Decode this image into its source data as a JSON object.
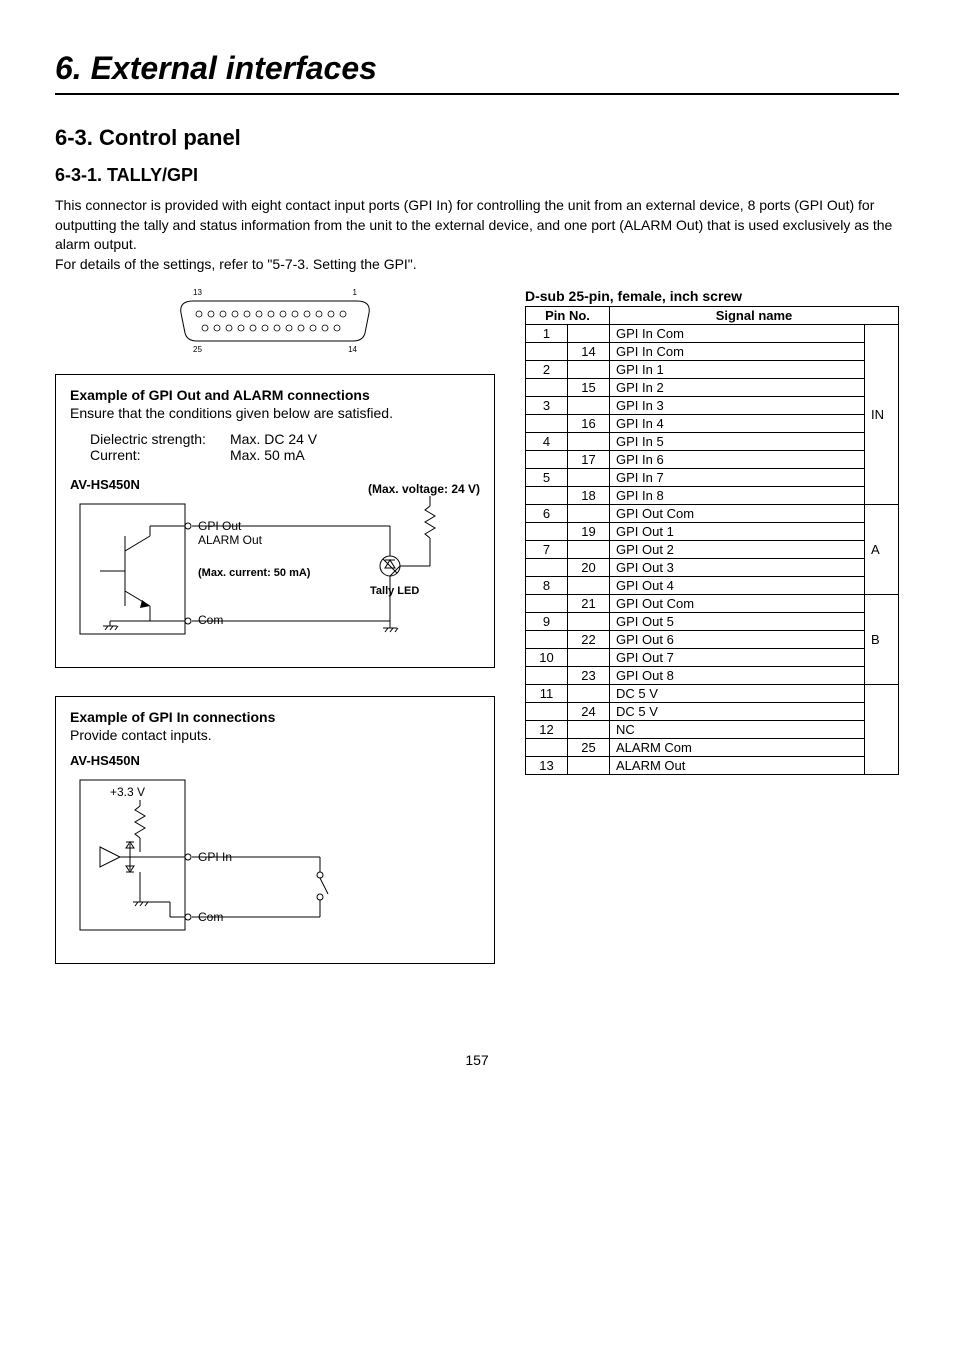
{
  "chapter": "6. External interfaces",
  "section": "6-3. Control panel",
  "subsection": "6-3-1. TALLY/GPI",
  "intro": "This connector is provided with eight contact input ports (GPI In) for controlling the unit from an external device, 8 ports (GPI Out) for outputting the tally and status information from the unit to the external device, and one port (ALARM Out) that is used exclusively as the alarm output.",
  "intro2": "For details of the settings, refer to \"5-7-3. Setting the GPI\".",
  "page_number": "157",
  "connector": {
    "top_left": "13",
    "top_right": "1",
    "bottom_left": "25",
    "bottom_right": "14"
  },
  "box1": {
    "title": "Example of GPI Out and ALARM connections",
    "sub": "Ensure that the conditions given below are satisfied.",
    "spec1_k": "Dielectric strength:",
    "spec1_v": "Max. DC 24 V",
    "spec2_k": "Current:",
    "spec2_v": "Max. 50 mA",
    "device": "AV-HS450N",
    "max_voltage": "(Max. voltage: 24 V)",
    "gpi_out": "GPI Out",
    "alarm_out": "ALARM Out",
    "max_current": "(Max. current: 50 mA)",
    "tally_led": "Tally LED",
    "com": "Com"
  },
  "box2": {
    "title": "Example of GPI In connections",
    "sub": "Provide contact inputs.",
    "device": "AV-HS450N",
    "v33": "+3.3 V",
    "gpi_in": "GPI In",
    "com": "Com"
  },
  "table": {
    "caption": "D-sub 25-pin, female, inch screw",
    "head_pin": "Pin No.",
    "head_sig": "Signal name",
    "rows": [
      {
        "a": "1",
        "b": "",
        "sig": "GPI In Com",
        "grp": "IN",
        "gstart": true,
        "gspan": 10
      },
      {
        "a": "",
        "b": "14",
        "sig": "GPI In Com"
      },
      {
        "a": "2",
        "b": "",
        "sig": "GPI In 1"
      },
      {
        "a": "",
        "b": "15",
        "sig": "GPI In 2"
      },
      {
        "a": "3",
        "b": "",
        "sig": "GPI In 3"
      },
      {
        "a": "",
        "b": "16",
        "sig": "GPI In 4"
      },
      {
        "a": "4",
        "b": "",
        "sig": "GPI In 5"
      },
      {
        "a": "",
        "b": "17",
        "sig": "GPI In 6"
      },
      {
        "a": "5",
        "b": "",
        "sig": "GPI In 7"
      },
      {
        "a": "",
        "b": "18",
        "sig": "GPI In 8"
      },
      {
        "a": "6",
        "b": "",
        "sig": "GPI Out Com",
        "grp": "A",
        "gstart": true,
        "gspan": 5
      },
      {
        "a": "",
        "b": "19",
        "sig": "GPI Out 1"
      },
      {
        "a": "7",
        "b": "",
        "sig": "GPI Out 2"
      },
      {
        "a": "",
        "b": "20",
        "sig": "GPI Out 3"
      },
      {
        "a": "8",
        "b": "",
        "sig": "GPI Out 4"
      },
      {
        "a": "",
        "b": "21",
        "sig": "GPI Out Com",
        "grp": "B",
        "gstart": true,
        "gspan": 5
      },
      {
        "a": "9",
        "b": "",
        "sig": "GPI Out 5"
      },
      {
        "a": "",
        "b": "22",
        "sig": "GPI Out 6"
      },
      {
        "a": "10",
        "b": "",
        "sig": "GPI Out 7"
      },
      {
        "a": "",
        "b": "23",
        "sig": "GPI Out 8"
      },
      {
        "a": "11",
        "b": "",
        "sig": "DC 5 V",
        "grp": "",
        "gstart": true,
        "gspan": 5
      },
      {
        "a": "",
        "b": "24",
        "sig": "DC 5 V"
      },
      {
        "a": "12",
        "b": "",
        "sig": "NC"
      },
      {
        "a": "",
        "b": "25",
        "sig": "ALARM Com"
      },
      {
        "a": "13",
        "b": "",
        "sig": "ALARM Out"
      }
    ]
  }
}
